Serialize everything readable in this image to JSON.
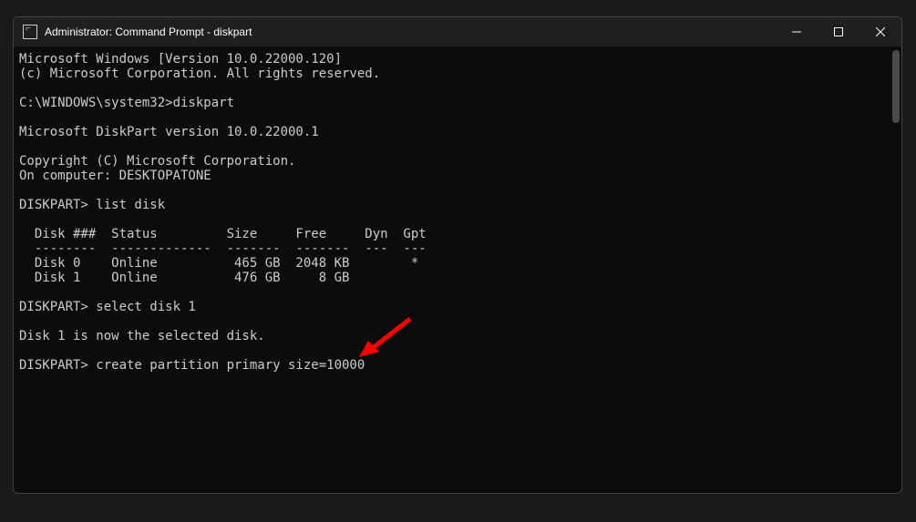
{
  "titlebar": {
    "title": "Administrator: Command Prompt - diskpart"
  },
  "terminal": {
    "line1": "Microsoft Windows [Version 10.0.22000.120]",
    "line2": "(c) Microsoft Corporation. All rights reserved.",
    "line3": "",
    "prompt1": "C:\\WINDOWS\\system32>",
    "cmd1": "diskpart",
    "line5": "",
    "line6": "Microsoft DiskPart version 10.0.22000.1",
    "line7": "",
    "line8": "Copyright (C) Microsoft Corporation.",
    "line9": "On computer: DESKTOPATONE",
    "line10": "",
    "prompt2": "DISKPART>",
    "cmd2": " list disk",
    "line12": "",
    "tableHeader": "  Disk ###  Status         Size     Free     Dyn  Gpt",
    "tableDivider": "  --------  -------------  -------  -------  ---  ---",
    "tableRow1": "  Disk 0    Online          465 GB  2048 KB        *",
    "tableRow2": "  Disk 1    Online          476 GB     8 GB",
    "line16": "",
    "prompt3": "DISKPART>",
    "cmd3": " select disk 1",
    "line18": "",
    "line19": "Disk 1 is now the selected disk.",
    "line20": "",
    "prompt4": "DISKPART>",
    "cmd4": " create partition primary size=10000"
  }
}
